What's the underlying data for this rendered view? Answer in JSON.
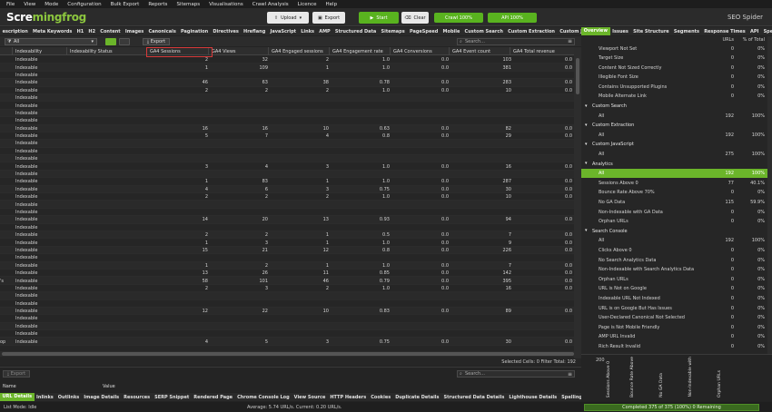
{
  "menu": [
    "File",
    "View",
    "Mode",
    "Configuration",
    "Bulk Export",
    "Reports",
    "Sitemaps",
    "Visualisations",
    "Crawl Analysis",
    "Licence",
    "Help"
  ],
  "toolbar": {
    "logo_part1": "Scre",
    "logo_part2": "mingfrog",
    "upload_label": "Upload",
    "export_label": "Export",
    "start_label": "Start",
    "clear_label": "Clear",
    "crawl_badge": "Crawl 100%",
    "api_badge": "API 100%",
    "product_name": "SEO Spider"
  },
  "tabs": [
    "escription",
    "Meta Keywords",
    "H1",
    "H2",
    "Content",
    "Images",
    "Canonicals",
    "Pagination",
    "Directives",
    "Hreflang",
    "JavaScript",
    "Links",
    "AMP",
    "Structured Data",
    "Sitemaps",
    "PageSpeed",
    "Mobile",
    "Custom Search",
    "Custom Extraction",
    "Custom JavaScript",
    "Analytics"
  ],
  "active_tab": "Analytics",
  "filter": {
    "value": "All",
    "export_label": "Export",
    "search_placeholder": "Search..."
  },
  "table": {
    "columns": [
      "Indexability",
      "Indexability Status",
      "GA4 Sessions",
      "GA4 Views",
      "GA4 Engaged sessions",
      "GA4 Engagement rate",
      "GA4 Conversions",
      "GA4 Event count",
      "GA4 Total revenue"
    ],
    "rows": [
      [
        "Indexable",
        "",
        "2",
        "32",
        "2",
        "1.0",
        "0.0",
        "103",
        "0.0"
      ],
      [
        "Indexable",
        "",
        "1",
        "109",
        "1",
        "1.0",
        "0.0",
        "381",
        "0.0"
      ],
      [
        "Indexable",
        "",
        "",
        "",
        "",
        "",
        "",
        "",
        ""
      ],
      [
        "Indexable",
        "",
        "46",
        "63",
        "38",
        "0.78",
        "0.0",
        "283",
        "0.0"
      ],
      [
        "Indexable",
        "",
        "2",
        "2",
        "2",
        "1.0",
        "0.0",
        "10",
        "0.0"
      ],
      [
        "Indexable",
        "",
        "",
        "",
        "",
        "",
        "",
        "",
        ""
      ],
      [
        "Indexable",
        "",
        "",
        "",
        "",
        "",
        "",
        "",
        ""
      ],
      [
        "Indexable",
        "",
        "",
        "",
        "",
        "",
        "",
        "",
        ""
      ],
      [
        "Indexable",
        "",
        "",
        "",
        "",
        "",
        "",
        "",
        ""
      ],
      [
        "Indexable",
        "",
        "16",
        "16",
        "10",
        "0.63",
        "0.0",
        "82",
        "0.0"
      ],
      [
        "Indexable",
        "",
        "5",
        "7",
        "4",
        "0.8",
        "0.0",
        "29",
        "0.0"
      ],
      [
        "Indexable",
        "",
        "",
        "",
        "",
        "",
        "",
        "",
        ""
      ],
      [
        "Indexable",
        "",
        "",
        "",
        "",
        "",
        "",
        "",
        ""
      ],
      [
        "Indexable",
        "",
        "",
        "",
        "",
        "",
        "",
        "",
        ""
      ],
      [
        "Indexable",
        "",
        "3",
        "4",
        "3",
        "1.0",
        "0.0",
        "16",
        "0.0"
      ],
      [
        "Indexable",
        "",
        "",
        "",
        "",
        "",
        "",
        "",
        ""
      ],
      [
        "Indexable",
        "",
        "1",
        "83",
        "1",
        "1.0",
        "0.0",
        "287",
        "0.0"
      ],
      [
        "Indexable",
        "",
        "4",
        "6",
        "3",
        "0.75",
        "0.0",
        "30",
        "0.0"
      ],
      [
        "Indexable",
        "",
        "2",
        "2",
        "2",
        "1.0",
        "0.0",
        "10",
        "0.0"
      ],
      [
        "Indexable",
        "",
        "",
        "",
        "",
        "",
        "",
        "",
        ""
      ],
      [
        "Indexable",
        "",
        "",
        "",
        "",
        "",
        "",
        "",
        ""
      ],
      [
        "Indexable",
        "",
        "14",
        "20",
        "13",
        "0.93",
        "0.0",
        "94",
        "0.0"
      ],
      [
        "Indexable",
        "",
        "",
        "",
        "",
        "",
        "",
        "",
        ""
      ],
      [
        "Indexable",
        "",
        "2",
        "2",
        "1",
        "0.5",
        "0.0",
        "7",
        "0.0"
      ],
      [
        "Indexable",
        "",
        "1",
        "3",
        "1",
        "1.0",
        "0.0",
        "9",
        "0.0"
      ],
      [
        "Indexable",
        "",
        "15",
        "21",
        "12",
        "0.8",
        "0.0",
        "226",
        "0.0"
      ],
      [
        "Indexable",
        "",
        "",
        "",
        "",
        "",
        "",
        "",
        ""
      ],
      [
        "Indexable",
        "",
        "1",
        "2",
        "1",
        "1.0",
        "0.0",
        "7",
        "0.0"
      ],
      [
        "Indexable",
        "",
        "13",
        "26",
        "11",
        "0.85",
        "0.0",
        "142",
        "0.0"
      ],
      [
        "Indexable",
        "",
        "58",
        "101",
        "46",
        "0.79",
        "0.0",
        "395",
        "0.0"
      ],
      [
        "Indexable",
        "",
        "2",
        "3",
        "2",
        "1.0",
        "0.0",
        "16",
        "0.0"
      ],
      [
        "Indexable",
        "",
        "",
        "",
        "",
        "",
        "",
        "",
        ""
      ],
      [
        "Indexable",
        "",
        "",
        "",
        "",
        "",
        "",
        "",
        ""
      ],
      [
        "Indexable",
        "",
        "12",
        "22",
        "10",
        "0.83",
        "0.0",
        "89",
        "0.0"
      ],
      [
        "Indexable",
        "",
        "",
        "",
        "",
        "",
        "",
        "",
        ""
      ],
      [
        "Indexable",
        "",
        "",
        "",
        "",
        "",
        "",
        "",
        ""
      ],
      [
        "Indexable",
        "",
        "",
        "",
        "",
        "",
        "",
        "",
        ""
      ],
      [
        "Indexable",
        "",
        "4",
        "5",
        "3",
        "0.75",
        "0.0",
        "30",
        "0.0"
      ]
    ],
    "left_prefixes": {
      "29": "'s",
      "37": "op"
    },
    "status_selected": "Selected Cells:  0  Filter Total:  192"
  },
  "bottom_panel": {
    "export_label": "Export",
    "search_placeholder": "Search...",
    "col_name": "Name",
    "col_value": "Value"
  },
  "bottom_tabs": [
    "URL Details",
    "Inlinks",
    "Outlinks",
    "Image Details",
    "Resources",
    "SERP Snippet",
    "Rendered Page",
    "Chrome Console Log",
    "View Source",
    "HTTP Headers",
    "Cookies",
    "Duplicate Details",
    "Structured Data Details",
    "Lighthouse Details",
    "Spelling & Grammar Details",
    "N"
  ],
  "bottom_tabs_active": "URL Details",
  "footer": {
    "mode": "List Mode: Idle",
    "stats": "Average: 5.74 URL/s. Current: 0.20 URL/s."
  },
  "right_panel": {
    "tabs": [
      "Overview",
      "Issues",
      "Site Structure",
      "Segments",
      "Response Times",
      "API",
      "Spelling"
    ],
    "active_tab": "Overview",
    "col_urls": "URLs",
    "col_pct": "% of Total",
    "items": [
      {
        "label": "Viewport Not Set",
        "urls": "0",
        "pct": "0%",
        "indent": 1,
        "type": "item"
      },
      {
        "label": "Target Size",
        "urls": "0",
        "pct": "0%",
        "indent": 1,
        "type": "item"
      },
      {
        "label": "Content Not Sized Correctly",
        "urls": "0",
        "pct": "0%",
        "indent": 1,
        "type": "item"
      },
      {
        "label": "Illegible Font Size",
        "urls": "0",
        "pct": "0%",
        "indent": 1,
        "type": "item"
      },
      {
        "label": "Contains Unsupported Plugins",
        "urls": "0",
        "pct": "0%",
        "indent": 1,
        "type": "item"
      },
      {
        "label": "Mobile Alternate Link",
        "urls": "0",
        "pct": "0%",
        "indent": 1,
        "type": "item"
      },
      {
        "label": "Custom Search",
        "urls": "",
        "pct": "",
        "indent": 0,
        "type": "section"
      },
      {
        "label": "All",
        "urls": "192",
        "pct": "100%",
        "indent": 1,
        "type": "item"
      },
      {
        "label": "Custom Extraction",
        "urls": "",
        "pct": "",
        "indent": 0,
        "type": "section"
      },
      {
        "label": "All",
        "urls": "192",
        "pct": "100%",
        "indent": 1,
        "type": "item"
      },
      {
        "label": "Custom JavaScript",
        "urls": "",
        "pct": "",
        "indent": 0,
        "type": "section"
      },
      {
        "label": "All",
        "urls": "275",
        "pct": "100%",
        "indent": 1,
        "type": "item"
      },
      {
        "label": "Analytics",
        "urls": "",
        "pct": "",
        "indent": 0,
        "type": "section"
      },
      {
        "label": "All",
        "urls": "192",
        "pct": "100%",
        "indent": 1,
        "type": "selected"
      },
      {
        "label": "Sessions Above 0",
        "urls": "77",
        "pct": "40.1%",
        "indent": 1,
        "type": "item"
      },
      {
        "label": "Bounce Rate Above 70%",
        "urls": "0",
        "pct": "0%",
        "indent": 1,
        "type": "item"
      },
      {
        "label": "No GA Data",
        "urls": "115",
        "pct": "59.9%",
        "indent": 1,
        "type": "item"
      },
      {
        "label": "Non-Indexable with GA Data",
        "urls": "0",
        "pct": "0%",
        "indent": 1,
        "type": "item"
      },
      {
        "label": "Orphan URLs",
        "urls": "0",
        "pct": "0%",
        "indent": 1,
        "type": "item"
      },
      {
        "label": "Search Console",
        "urls": "",
        "pct": "",
        "indent": 0,
        "type": "section"
      },
      {
        "label": "All",
        "urls": "192",
        "pct": "100%",
        "indent": 1,
        "type": "item"
      },
      {
        "label": "Clicks Above 0",
        "urls": "0",
        "pct": "0%",
        "indent": 1,
        "type": "item"
      },
      {
        "label": "No Search Analytics Data",
        "urls": "0",
        "pct": "0%",
        "indent": 1,
        "type": "item"
      },
      {
        "label": "Non-Indexable with Search Analytics Data",
        "urls": "0",
        "pct": "0%",
        "indent": 1,
        "type": "item"
      },
      {
        "label": "Orphan URLs",
        "urls": "0",
        "pct": "0%",
        "indent": 1,
        "type": "item"
      },
      {
        "label": "URL is Not on Google",
        "urls": "0",
        "pct": "0%",
        "indent": 1,
        "type": "item"
      },
      {
        "label": "Indexable URL Not Indexed",
        "urls": "0",
        "pct": "0%",
        "indent": 1,
        "type": "item"
      },
      {
        "label": "URL is on Google But Has Issues",
        "urls": "0",
        "pct": "0%",
        "indent": 1,
        "type": "item"
      },
      {
        "label": "User-Declared Canonical Not Selected",
        "urls": "0",
        "pct": "0%",
        "indent": 1,
        "type": "item"
      },
      {
        "label": "Page is Not Mobile Friendly",
        "urls": "0",
        "pct": "0%",
        "indent": 1,
        "type": "item"
      },
      {
        "label": "AMP URL Invalid",
        "urls": "0",
        "pct": "0%",
        "indent": 1,
        "type": "item"
      },
      {
        "label": "Rich Result Invalid",
        "urls": "0",
        "pct": "0%",
        "indent": 1,
        "type": "item"
      }
    ],
    "graph_value": "200",
    "graph_labels": [
      "Sessions Above 0",
      "Bounce Rate Above",
      "No GA Data",
      "Non-Indexable with",
      "Orphan URLs"
    ],
    "progress": "Completed 375 of 375 (100%) 0 Remaining"
  },
  "colors": {
    "accent": "#6bb52a",
    "highlight_box": "#d83a3a",
    "background": "#232323"
  }
}
